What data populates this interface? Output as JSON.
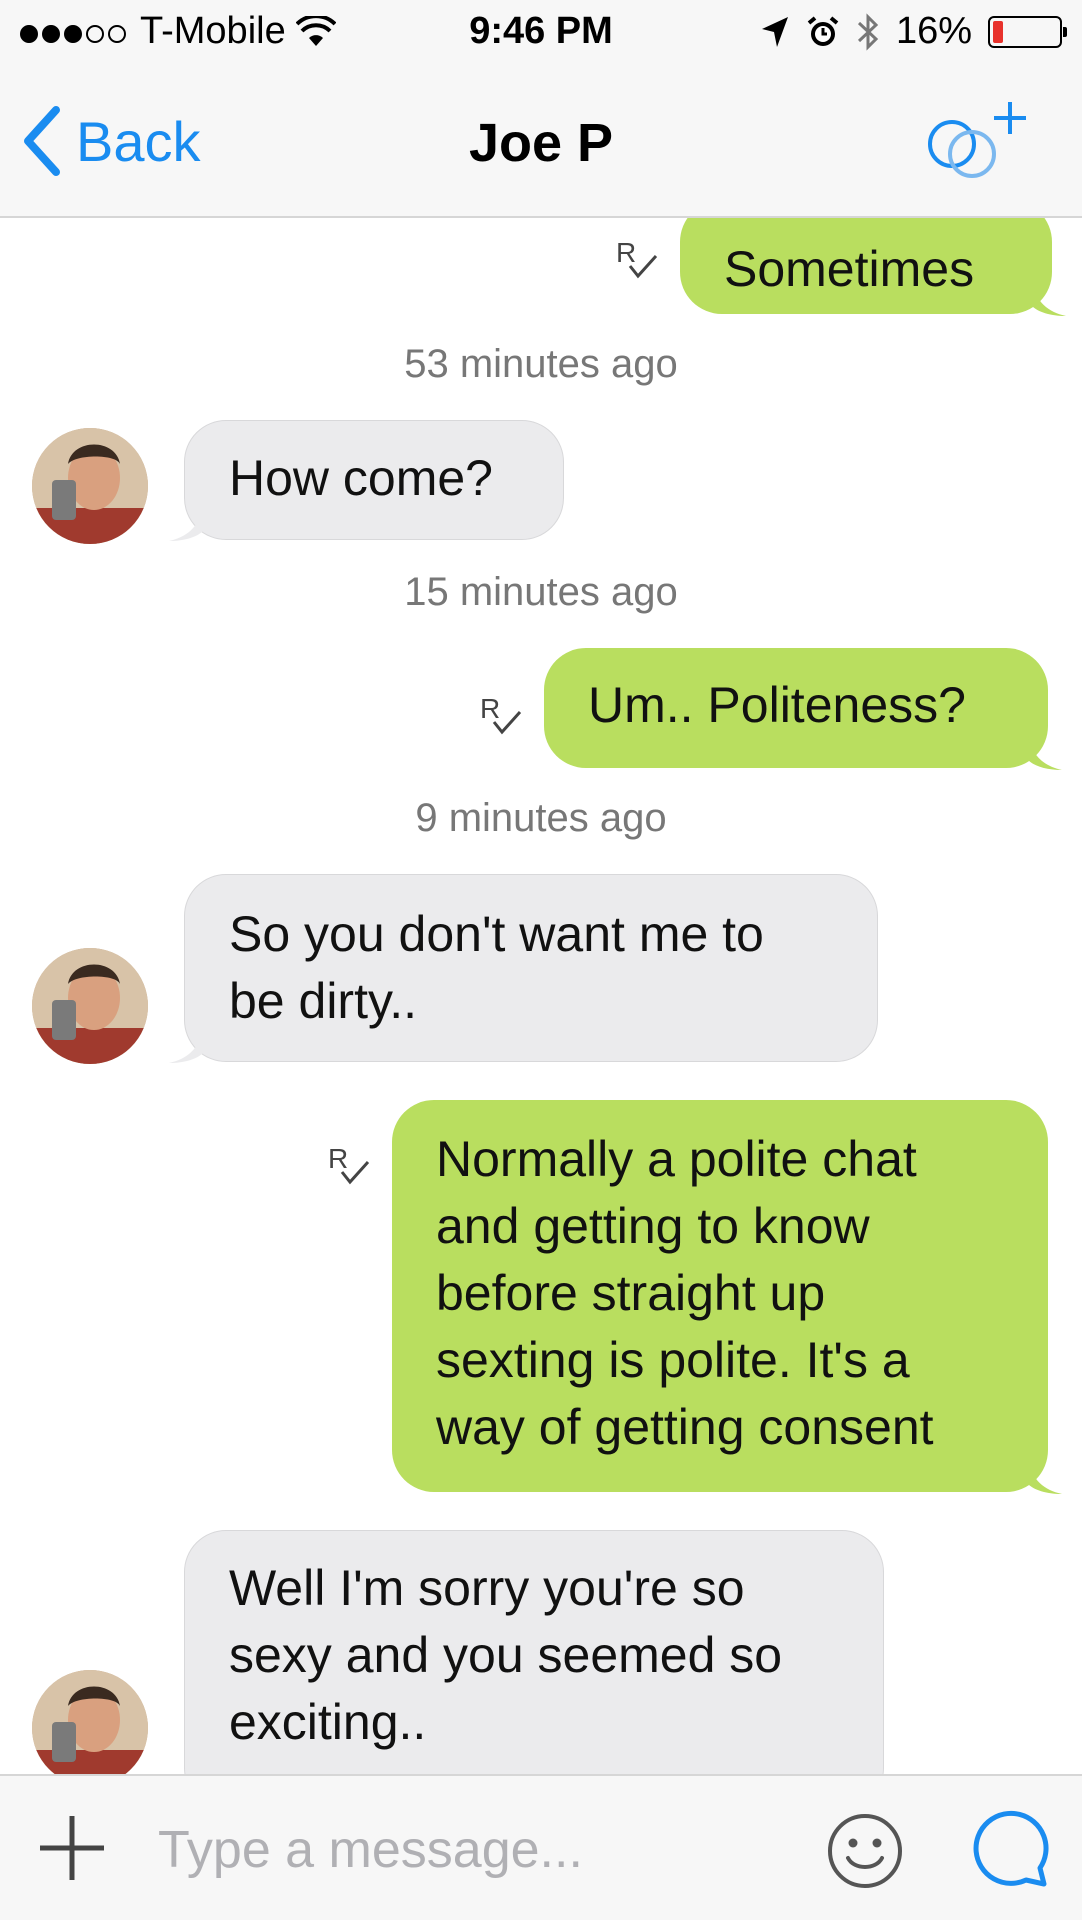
{
  "status_bar": {
    "carrier": "T-Mobile",
    "signal_bars_filled": 3,
    "signal_bars_total": 5,
    "time": "9:46 PM",
    "battery_percent": "16%",
    "battery_level": 0.16,
    "icons": [
      "wifi-icon",
      "location-arrow-icon",
      "alarm-icon",
      "bluetooth-icon",
      "battery-icon"
    ]
  },
  "nav": {
    "back_label": "Back",
    "title": "Joe P",
    "add_icon": "add-conversation-icon"
  },
  "messages": [
    {
      "type": "sent",
      "text": "Sometimes",
      "read_receipt": "R"
    },
    {
      "type": "timestamp",
      "text": "53 minutes ago"
    },
    {
      "type": "received",
      "text": "How come?"
    },
    {
      "type": "timestamp",
      "text": "15 minutes ago"
    },
    {
      "type": "sent",
      "text": "Um.. Politeness?",
      "read_receipt": "R"
    },
    {
      "type": "timestamp",
      "text": "9 minutes ago"
    },
    {
      "type": "received",
      "lines": [
        "So you don't want me to",
        "be dirty.."
      ]
    },
    {
      "type": "sent",
      "lines": [
        "Normally a polite chat",
        "and getting to know",
        "before straight up",
        "sexting is polite. It's a",
        "way of getting consent"
      ],
      "read_receipt": "R"
    },
    {
      "type": "received",
      "lines": [
        "Well I'm sorry you're so",
        "sexy and you seemed so",
        "exciting.."
      ]
    }
  ],
  "input": {
    "placeholder": "Type a message...",
    "value": ""
  },
  "colors": {
    "accent": "#1a8cf0",
    "sent_bubble": "#b9de5f",
    "received_bubble": "#ebebed",
    "battery_low": "#e8322c"
  }
}
